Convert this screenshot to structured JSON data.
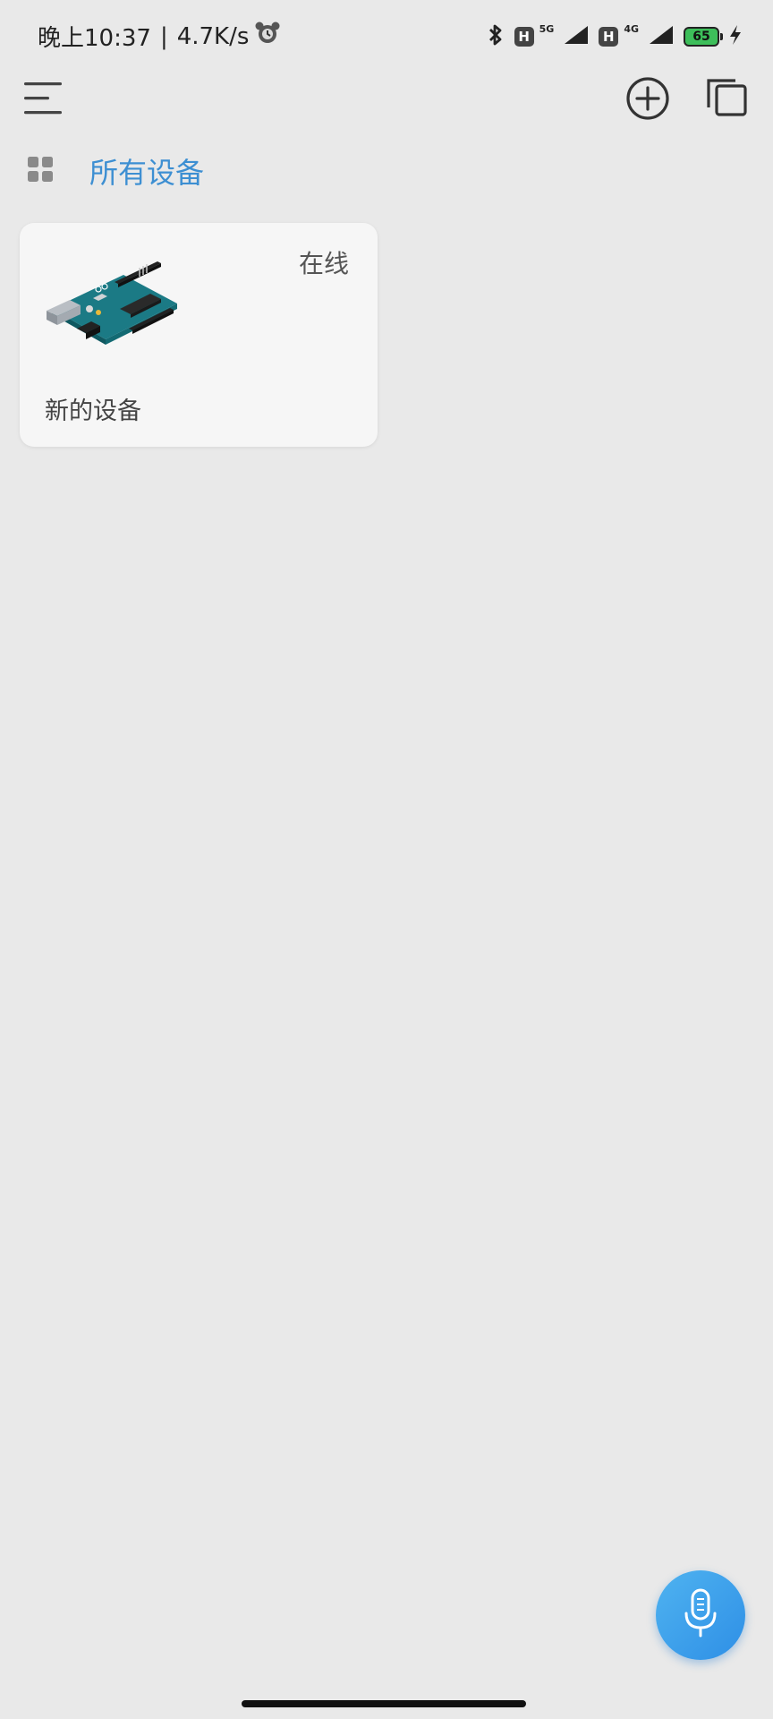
{
  "status_bar": {
    "time": "晚上10:37",
    "separator": "|",
    "net_speed": "4.7K/s",
    "sim1_network": "5G",
    "sim2_network": "4G",
    "hd_label": "H",
    "battery_level": "65",
    "icons": [
      "alarm-icon",
      "bluetooth-icon",
      "hd-icon",
      "signal-icon",
      "battery-icon",
      "charging-icon"
    ]
  },
  "toolbar": {
    "icons": [
      "menu-icon",
      "add-circle-icon",
      "multi-select-icon"
    ]
  },
  "group": {
    "icon": "grid-icon",
    "title": "所有设备",
    "accent_color": "#3d8fd2"
  },
  "devices": [
    {
      "name": "新的设备",
      "status": "在线",
      "image": "arduino-board"
    }
  ],
  "voice_button": {
    "icon": "microphone-icon",
    "color": "#3a9ee8"
  }
}
